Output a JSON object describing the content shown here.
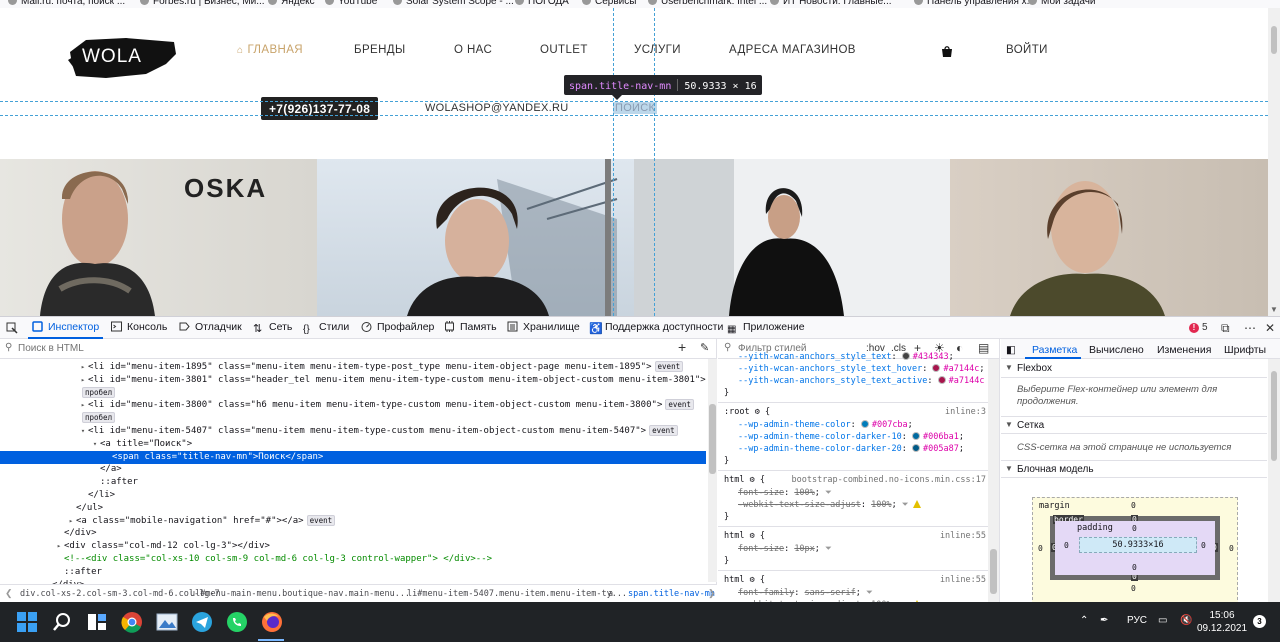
{
  "bookmarks": [
    {
      "label": "Mail.ru: почта, поиск ..."
    },
    {
      "label": "Forbes.ru | Бизнес, Ми..."
    },
    {
      "label": "Яндекс"
    },
    {
      "label": "YouTube"
    },
    {
      "label": "Solar System Scope - ..."
    },
    {
      "label": "ПОГОДА"
    },
    {
      "label": "Сервисы"
    },
    {
      "label": "Userbenchmark: Intel ..."
    },
    {
      "label": "ИТ Новости: Главные..."
    },
    {
      "label": "Панель управления х..."
    },
    {
      "label": "Мои задачи"
    }
  ],
  "site": {
    "logo_text": "WOLA",
    "nav": [
      {
        "label": "ГЛАВНАЯ",
        "active": true
      },
      {
        "label": "БРЕНДЫ"
      },
      {
        "label": "О НАС"
      },
      {
        "label": "OUTLET"
      },
      {
        "label": "УСЛУГИ"
      },
      {
        "label": "АДРЕСА МАГАЗИНОВ"
      }
    ],
    "login": "ВОЙТИ",
    "phone": "+7(926)137-77-08",
    "email": "WOLASHOP@YANDEX.RU",
    "search": "ПОИСК",
    "banner_brand": "OSKA",
    "cart_icon": "shopping-bag-icon"
  },
  "highlighter": {
    "selector": "span.title-nav-mn",
    "size": "50.9333 × 16"
  },
  "devtools": {
    "tabs": [
      {
        "label": "Инспектор",
        "selected": true
      },
      {
        "label": "Консоль"
      },
      {
        "label": "Отладчик"
      },
      {
        "label": "Сеть"
      },
      {
        "label": "Стили"
      },
      {
        "label": "Профайлер"
      },
      {
        "label": "Память"
      },
      {
        "label": "Хранилище"
      },
      {
        "label": "Поддержка доступности"
      },
      {
        "label": "Приложение"
      }
    ],
    "error_count": "5",
    "inspector": {
      "search_placeholder": "Поиск в HTML",
      "lines": [
        {
          "indent": 0,
          "twisty": "▸",
          "html": "<li id=\"menu-item-1895\" class=\"menu-item menu-item-type-post_type menu-item-object-page menu-item-1895\">",
          "event": true
        },
        {
          "indent": 0,
          "twisty": "▸",
          "html": "<li id=\"menu-item-3801\" class=\"header_tel menu-item menu-item-type-custom menu-item-object-custom menu-item-3801\">",
          "event": true
        },
        {
          "indent": 0,
          "twisty": "",
          "html": "пробел",
          "badge": true
        },
        {
          "indent": 0,
          "twisty": "▸",
          "html": "<li id=\"menu-item-3800\" class=\"h6 menu-item menu-item-type-custom menu-item-object-custom menu-item-3800\">",
          "event": true
        },
        {
          "indent": 0,
          "twisty": "",
          "html": "пробел",
          "badge": true
        },
        {
          "indent": 0,
          "twisty": "▾",
          "html": "<li id=\"menu-item-5407\" class=\"menu-item menu-item-type-custom menu-item-object-custom menu-item-5407\">",
          "event": true
        },
        {
          "indent": 1,
          "twisty": "▾",
          "html": "<a title=\"Поиск\">"
        },
        {
          "indent": 2,
          "twisty": "",
          "html": "<span class=\"title-nav-mn\">Поиск</span>",
          "selected": true
        },
        {
          "indent": 1,
          "twisty": "",
          "html": "</a>"
        },
        {
          "indent": 1,
          "twisty": "",
          "html": "::after"
        },
        {
          "indent": 0,
          "twisty": "",
          "html": "</li>"
        },
        {
          "indent": -1,
          "twisty": "",
          "html": "</ul>"
        },
        {
          "indent": -1,
          "twisty": "▸",
          "html": "<a class=\"mobile-navigation\" href=\"#\"></a>",
          "event": true
        },
        {
          "indent": -2,
          "twisty": "",
          "html": "</div>"
        },
        {
          "indent": -2,
          "twisty": "▸",
          "html": "<div class=\"col-md-12 col-lg-3\"></div>"
        },
        {
          "indent": -2,
          "twisty": "",
          "html": "<!--<div class=\"col-xs-10 col-sm-9 col-md-6 col-lg-3 control-wapper\"> </div>-->",
          "comment": true
        },
        {
          "indent": -2,
          "twisty": "",
          "html": "::after"
        },
        {
          "indent": -3,
          "twisty": "",
          "html": "</div>"
        }
      ],
      "event_label": "event",
      "breadcrumbs": [
        "div.col-xs-2.col-sm-3.col-md-6.col-lg-7",
        "ul#menu-main-menu.boutique-nav.main-menu...",
        "li#menu-item-5407.menu-item.menu-item-ty...",
        "a",
        "span.title-nav-mn"
      ]
    },
    "rules": {
      "filter_placeholder": "Фильтр стилей",
      "hov": ":hov",
      "cls": ".cls",
      "blocks": [
        {
          "lines": [
            {
              "prop": "--yith-wcan-anchors_style_text",
              "val": "#434343",
              "color": "#434343"
            },
            {
              "prop": "--yith-wcan-anchors_style_text_hover",
              "val": "#a7144c",
              "color": "#a7144c"
            },
            {
              "prop": "--yith-wcan-anchors_style_text_active",
              "val": "#a7144c",
              "color": "#a7144c"
            }
          ],
          "close": "}"
        },
        {
          "selector": ":root",
          "source": "inline:3",
          "lines": [
            {
              "prop": "--wp-admin-theme-color",
              "val": "#007cba",
              "color": "#007cba"
            },
            {
              "prop": "--wp-admin-theme-color-darker-10",
              "val": "#006ba1",
              "color": "#006ba1"
            },
            {
              "prop": "--wp-admin-theme-color-darker-20",
              "val": "#005a87",
              "color": "#005a87"
            }
          ],
          "close": "}"
        },
        {
          "selector": "html",
          "source": "bootstrap-combined.no-icons.min.css:17",
          "lines": [
            {
              "prop": "font-size",
              "val": "100%",
              "strike": true
            },
            {
              "prop": "-webkit-text-size-adjust",
              "val": "100%",
              "strike": true,
              "warn": true
            }
          ],
          "close": "}"
        },
        {
          "selector": "html",
          "source": "inline:55",
          "lines": [
            {
              "prop": "font-size",
              "val": "10px",
              "strike": true
            }
          ],
          "close": "}"
        },
        {
          "selector": "html",
          "source": "inline:55",
          "lines": [
            {
              "prop": "font-family",
              "val": "sans-serif",
              "strike": true
            },
            {
              "prop": "-webkit-text-size-adjust",
              "val": "100%",
              "strike": true,
              "warn": true
            }
          ],
          "close": "}"
        }
      ]
    },
    "layout": {
      "tabs": [
        {
          "label": "Разметка",
          "selected": true
        },
        {
          "label": "Вычислено"
        },
        {
          "label": "Изменения"
        },
        {
          "label": "Шрифты"
        }
      ],
      "flexbox_title": "Flexbox",
      "flexbox_text": "Выберите Flex-контейнер или элемент для продолжения.",
      "grid_title": "Сетка",
      "grid_text": "CSS-сетка на этой странице не используется",
      "boxmodel_title": "Блочная модель",
      "boxmodel": {
        "margin_label": "margin",
        "border_label": "border",
        "padding_label": "padding",
        "content": "50.9333×16",
        "margin_top": "0",
        "margin_right": "0",
        "margin_bottom": "0",
        "margin_left": "0",
        "border_top": "0",
        "border_right": "0",
        "border_bottom": "0",
        "border_left": "0",
        "padding_top": "0",
        "padding_right": "0",
        "padding_bottom": "0",
        "padding_left": "0"
      }
    }
  },
  "taskbar": {
    "apps": [
      "windows-start-icon",
      "search-icon",
      "task-view-icon",
      "chrome-icon",
      "photos-icon",
      "telegram-icon",
      "whatsapp-icon",
      "firefox-icon"
    ],
    "lang": "РУС",
    "time": "15:06",
    "date": "09.12.2021",
    "notifications": "3"
  }
}
